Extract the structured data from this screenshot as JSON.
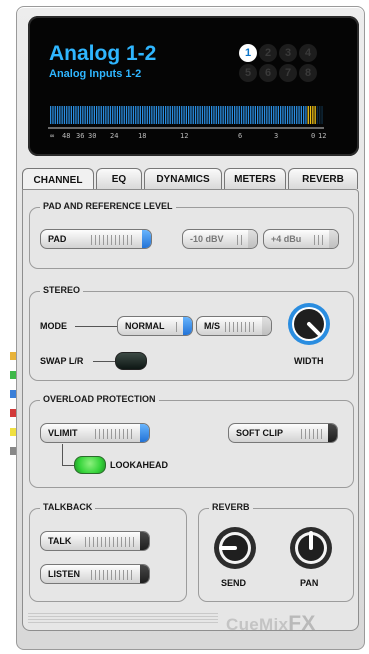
{
  "display": {
    "title": "Analog 1-2",
    "subtitle": "Analog Inputs 1-2",
    "channels": [
      "1",
      "2",
      "3",
      "4",
      "5",
      "6",
      "7",
      "8"
    ],
    "active_channel": "1",
    "meter_scale": [
      "∞",
      "48",
      "36",
      "30",
      "24",
      "18",
      "12",
      "6",
      "3",
      "0",
      "12"
    ]
  },
  "tabs": [
    "CHANNEL",
    "EQ",
    "DYNAMICS",
    "METERS",
    "REVERB"
  ],
  "active_tab": "CHANNEL",
  "pad_group": {
    "label": "PAD AND REFERENCE LEVEL",
    "pad": "PAD",
    "ref_minus10": "-10 dBV",
    "ref_plus4": "+4 dBu"
  },
  "stereo": {
    "label": "STEREO",
    "mode_label": "MODE",
    "normal": "NORMAL",
    "ms": "M/S",
    "swap": "SWAP L/R",
    "width": "WIDTH"
  },
  "overload": {
    "label": "OVERLOAD PROTECTION",
    "vlimit": "VLIMIT",
    "lookahead": "LOOKAHEAD",
    "soft_clip": "SOFT CLIP"
  },
  "talkback": {
    "label": "TALKBACK",
    "talk": "TALK",
    "listen": "LISTEN"
  },
  "reverb": {
    "label": "REVERB",
    "send": "SEND",
    "pan": "PAN"
  },
  "brand": {
    "logo_cue": "CueMix",
    "logo_fx": "FX"
  },
  "colors": {
    "accent_blue": "#2fb6ff",
    "led_green": "#35d43a",
    "meter_blue": "#2a8de0",
    "meter_yellow": "#f2c316"
  }
}
